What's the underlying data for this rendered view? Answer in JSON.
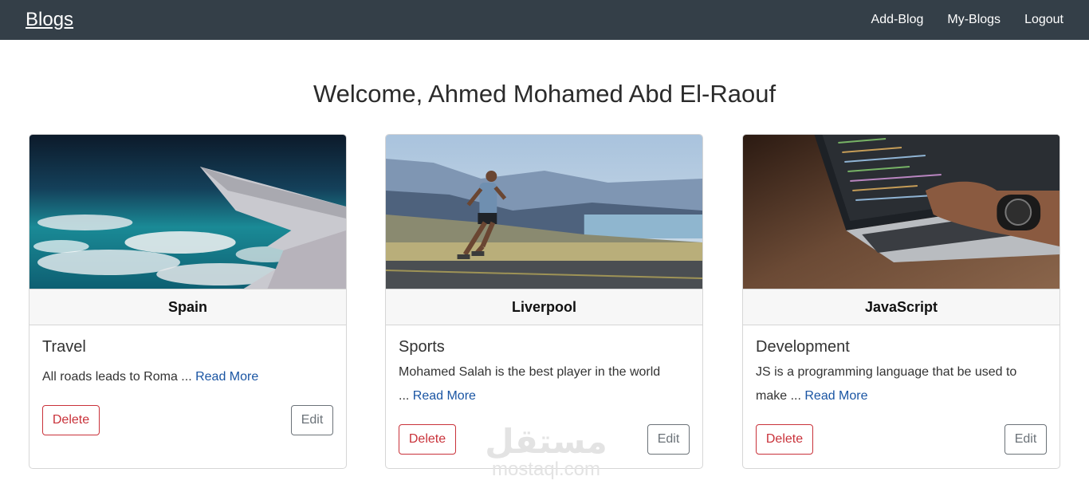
{
  "navbar": {
    "brand": "Blogs",
    "links": [
      "Add-Blog",
      "My-Blogs",
      "Logout"
    ]
  },
  "welcome": "Welcome, Ahmed Mohamed Abd El-Raouf",
  "cards": [
    {
      "title": "Spain",
      "category": "Travel",
      "text": "All roads leads to Roma",
      "dots": " ... ",
      "read_more": "Read More",
      "delete_label": "Delete",
      "edit_label": "Edit",
      "image": "airplane-wing-over-clouds"
    },
    {
      "title": "Liverpool",
      "category": "Sports",
      "text": "Mohamed Salah is the best player in the world",
      "dots": " ... ",
      "read_more": "Read More",
      "delete_label": "Delete",
      "edit_label": "Edit",
      "image": "runner-on-road-mountains"
    },
    {
      "title": "JavaScript",
      "category": "Development",
      "text": "JS is a programming language that be used to make",
      "dots": "  ... ",
      "read_more": "Read More",
      "delete_label": "Delete",
      "edit_label": "Edit",
      "image": "laptop-coding-hands"
    }
  ],
  "watermark": {
    "arabic": "مستقل",
    "latin": "mostaql.com"
  }
}
